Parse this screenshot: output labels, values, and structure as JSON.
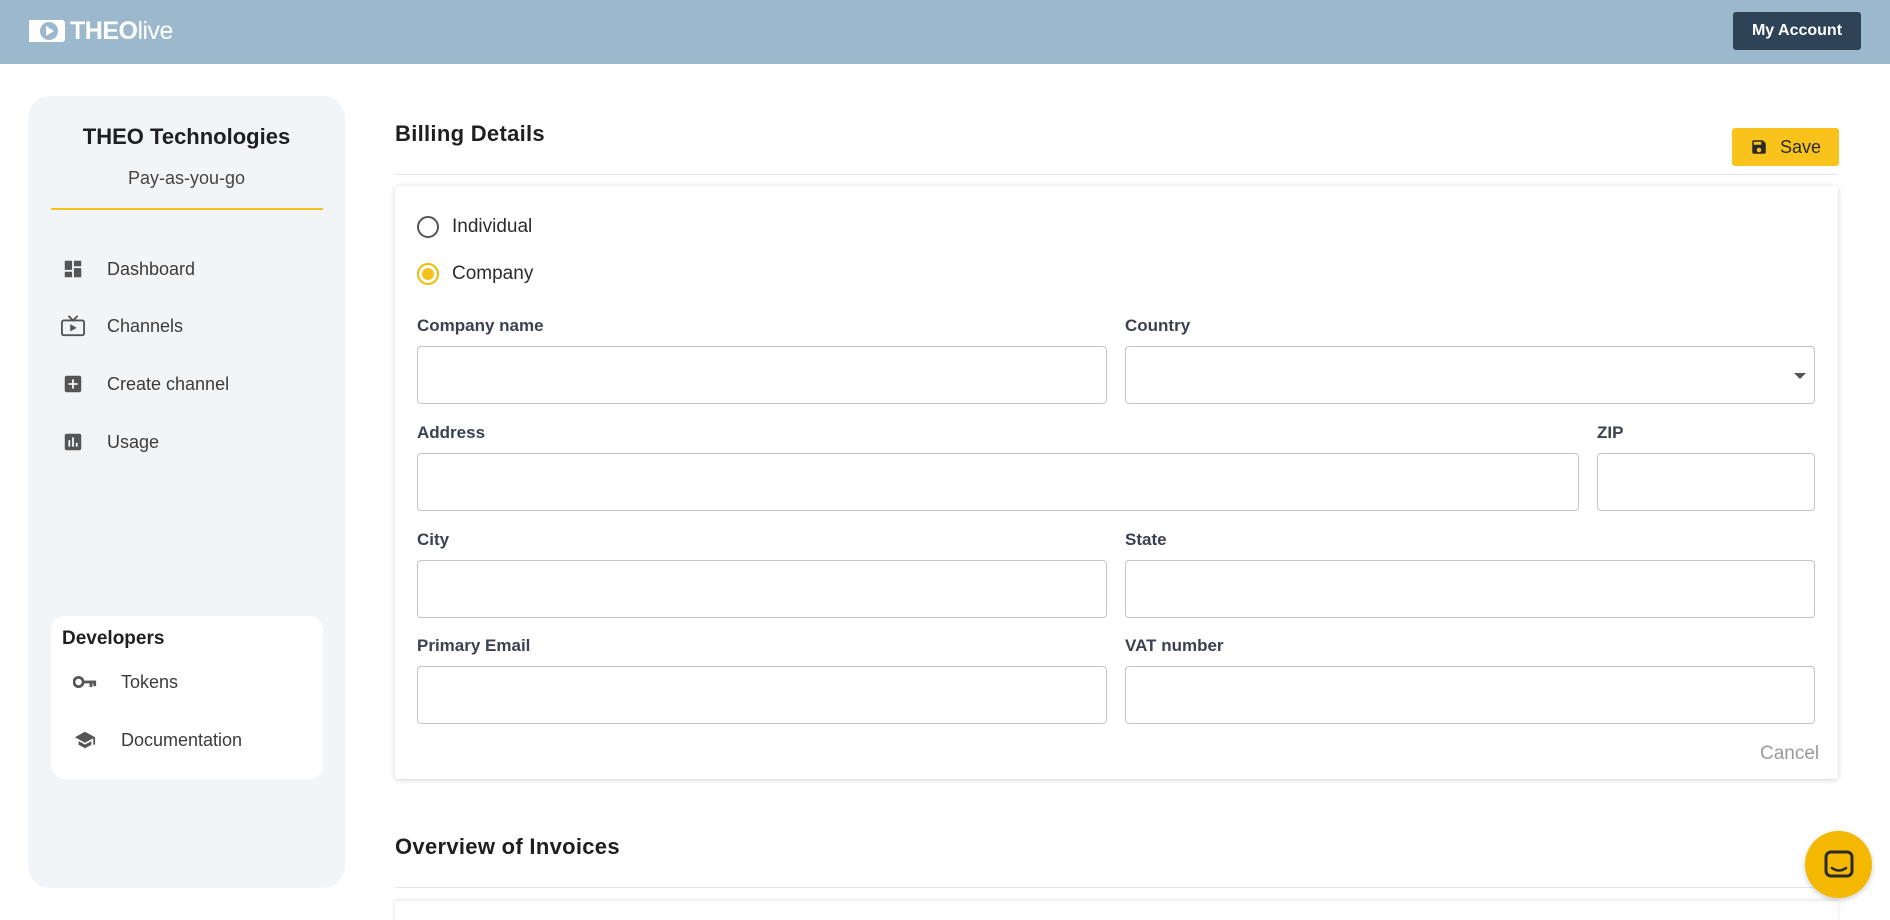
{
  "header": {
    "logo_bold": "THEO",
    "logo_light": "live",
    "account_button": "My Account"
  },
  "sidebar": {
    "org_name": "THEO Technologies",
    "plan": "Pay-as-you-go",
    "items": [
      {
        "label": "Dashboard",
        "icon": "dashboard-icon"
      },
      {
        "label": "Channels",
        "icon": "tv-icon"
      },
      {
        "label": "Create channel",
        "icon": "add-box-icon"
      },
      {
        "label": "Usage",
        "icon": "bar-chart-icon"
      }
    ],
    "developers": {
      "title": "Developers",
      "items": [
        {
          "label": "Tokens",
          "icon": "key-icon"
        },
        {
          "label": "Documentation",
          "icon": "graduation-cap-icon"
        }
      ]
    }
  },
  "billing": {
    "title": "Billing Details",
    "save_label": "Save",
    "entity_options": [
      {
        "label": "Individual",
        "checked": false
      },
      {
        "label": "Company",
        "checked": true
      }
    ],
    "fields": {
      "company_name": {
        "label": "Company name",
        "value": ""
      },
      "country": {
        "label": "Country",
        "value": ""
      },
      "address": {
        "label": "Address",
        "value": ""
      },
      "zip": {
        "label": "ZIP",
        "value": ""
      },
      "city": {
        "label": "City",
        "value": ""
      },
      "state": {
        "label": "State",
        "value": ""
      },
      "primary_email": {
        "label": "Primary Email",
        "value": ""
      },
      "vat_number": {
        "label": "VAT number",
        "value": ""
      }
    },
    "cancel_label": "Cancel"
  },
  "invoices": {
    "title": "Overview of Invoices"
  },
  "colors": {
    "header_bg": "#9bb8cc",
    "account_button_bg": "#2e4356",
    "accent_yellow": "#f9c31b",
    "sidebar_bg": "#f2f5f8"
  }
}
